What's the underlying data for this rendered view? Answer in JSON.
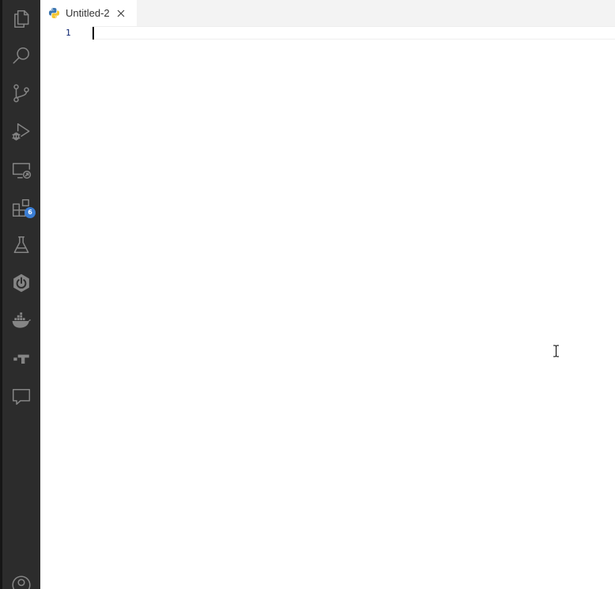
{
  "activity_bar": {
    "items": [
      {
        "icon": "files-icon"
      },
      {
        "icon": "search-icon"
      },
      {
        "icon": "source-control-icon"
      },
      {
        "icon": "run-debug-icon"
      },
      {
        "icon": "remote-explorer-icon"
      },
      {
        "icon": "extensions-icon",
        "badge": "6"
      },
      {
        "icon": "testing-flask-icon"
      },
      {
        "icon": "spring-boot-icon"
      },
      {
        "icon": "docker-icon"
      },
      {
        "icon": "gitlens-icon"
      },
      {
        "icon": "comments-icon"
      },
      {
        "icon": "account-icon"
      }
    ],
    "colors": {
      "background": "#2c2c2c",
      "icon": "#858585",
      "badge": "#3a7dd4"
    }
  },
  "tabs": [
    {
      "label": "Untitled-2",
      "icon": "python-file-icon",
      "active": true
    }
  ],
  "editor": {
    "lines": [
      {
        "number": "1",
        "text": ""
      }
    ],
    "colors": {
      "line_number": "#0b216f",
      "cursor": "#000000"
    }
  }
}
